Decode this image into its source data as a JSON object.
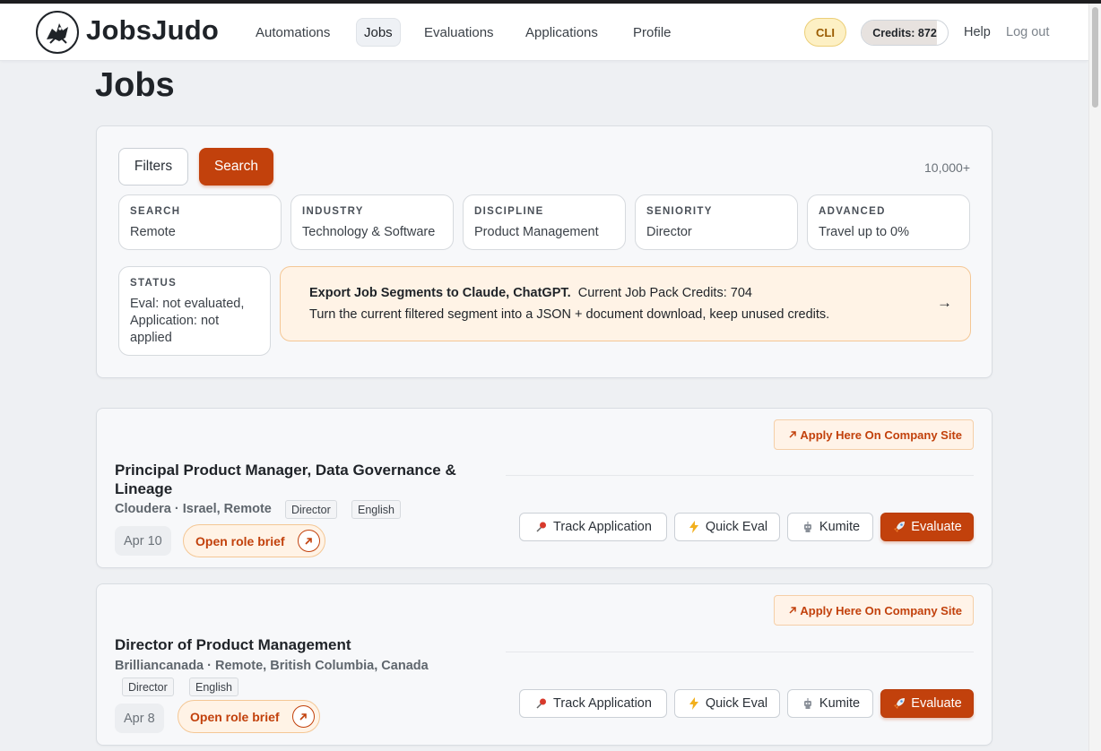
{
  "nav": {
    "brand": "JobsJudo",
    "items": [
      {
        "label": "Automations",
        "active": false
      },
      {
        "label": "Jobs",
        "active": true
      },
      {
        "label": "Evaluations",
        "active": false
      },
      {
        "label": "Applications",
        "active": false
      },
      {
        "label": "Profile",
        "active": false
      }
    ],
    "cli_label": "CLI",
    "credits_label": "Credits: 872",
    "credits_fill_fraction": 0.88,
    "help_label": "Help",
    "logout_label": "Log out"
  },
  "page": {
    "title": "Jobs"
  },
  "filters": {
    "filters_label": "Filters",
    "search_label": "Search",
    "result_count": "10,000+",
    "chips": [
      {
        "label": "SEARCH",
        "value": "Remote"
      },
      {
        "label": "INDUSTRY",
        "value": "Technology & Software"
      },
      {
        "label": "DISCIPLINE",
        "value": "Product Management"
      },
      {
        "label": "SENIORITY",
        "value": "Director"
      },
      {
        "label": "ADVANCED",
        "value": "Travel up to 0%"
      },
      {
        "label": "STATUS",
        "value": "Eval: not evaluated, Application: not applied"
      }
    ]
  },
  "export": {
    "title": "Export Job Segments to Claude, ChatGPT.",
    "credits_text": "Current Job Pack Credits: 704",
    "description": "Turn the current filtered segment into a JSON + document download, keep unused credits.",
    "arrow": "→"
  },
  "jobs": [
    {
      "title": "Principal Product Manager, Data Governance & Lineage",
      "meta": "Cloudera · Israel, Remote",
      "tags": [
        "Director",
        "English"
      ],
      "date": "Apr 10",
      "brief_label": "Open role brief",
      "apply_label": "Apply Here On Company Site",
      "actions": [
        "Track Application",
        "Quick Eval",
        "Kumite",
        "Evaluate"
      ]
    },
    {
      "title": "Director of Product Management",
      "meta": "Brilliancanada · Remote, British Columbia, Canada",
      "tags": [
        "Director",
        "English"
      ],
      "date": "Apr 8",
      "brief_label": "Open role brief",
      "apply_label": "Apply Here On Company Site",
      "actions": [
        "Track Application",
        "Quick Eval",
        "Kumite",
        "Evaluate"
      ]
    }
  ],
  "colors": {
    "accent": "#c2410c",
    "accent_soft": "#fff3e6",
    "cli_bg": "#fdf0c4"
  },
  "icons": [
    "jobsjudo-logo",
    "external-link-icon",
    "arrow-up-right-icon",
    "pushpin-icon",
    "lightning-icon",
    "robot-icon",
    "rocket-icon"
  ]
}
